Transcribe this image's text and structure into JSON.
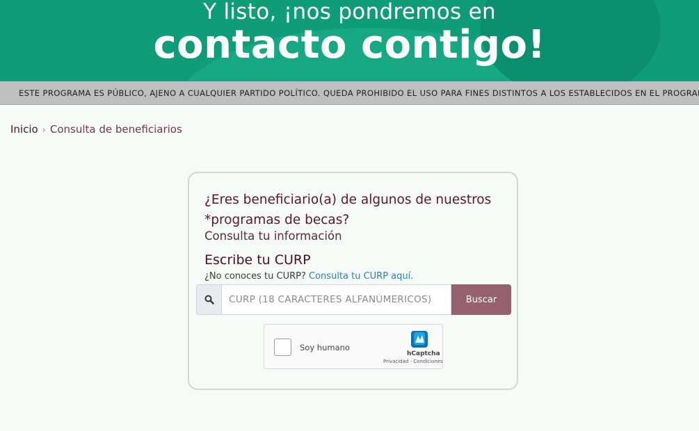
{
  "banner": {
    "line1": "Y listo, ¡nos pondremos en",
    "line2": "contacto contigo!"
  },
  "ticker": {
    "text": "ESTE PROGRAMA ES PÚBLICO, AJENO A CUALQUIER PARTIDO POLÍTICO. QUEDA PROHIBIDO EL USO PARA FINES DISTINTOS A LOS ESTABLECIDOS EN EL PROGRAMA"
  },
  "breadcrumb": {
    "home": "Inicio",
    "separator": "›",
    "current": "Consulta de beneficiarios"
  },
  "form": {
    "question": "¿Eres beneficiario(a) de algunos de nuestros *programas de becas?",
    "subtitle": "Consulta tu información",
    "curp_heading": "Escribe tu CURP",
    "help_prefix": "¿No conoces tu CURP?",
    "help_link": "Consulta tu CURP aquí.",
    "input_placeholder": "CURP (18 CARACTERES ALFANÚMERICOS)",
    "search_button": "Buscar",
    "search_icon": "search-icon"
  },
  "captcha": {
    "label": "Soy humano",
    "brand": "hCaptcha",
    "legal": "Privacidad - Condiciones"
  },
  "colors": {
    "banner": "#0f9d79",
    "accent": "#95616f",
    "title": "#5a1530",
    "link": "#2a7fc2"
  }
}
